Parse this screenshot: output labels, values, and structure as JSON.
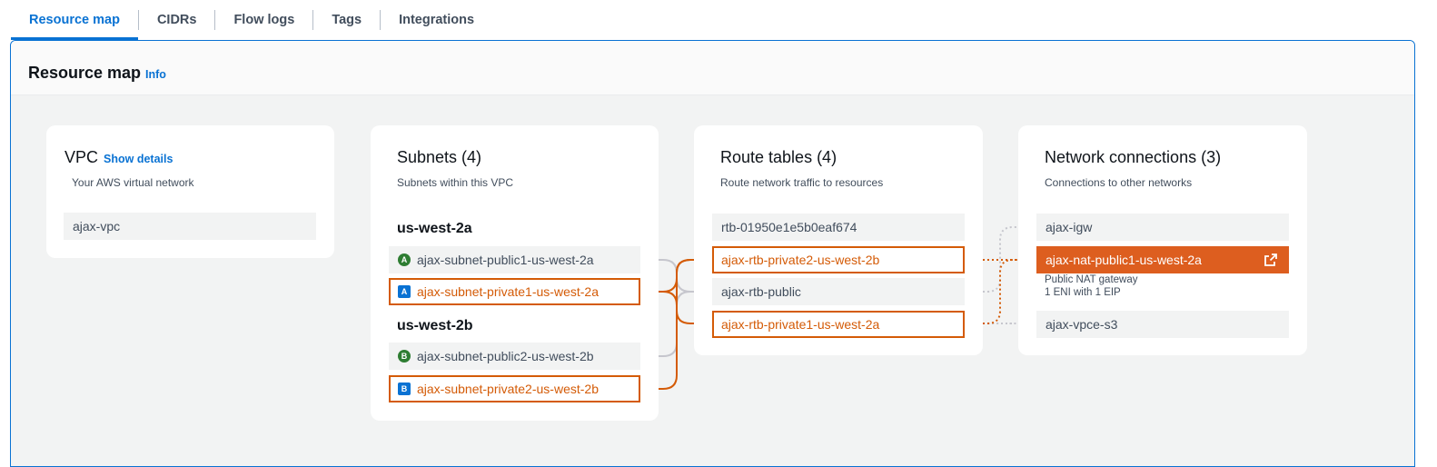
{
  "tabs": [
    {
      "label": "Resource map"
    },
    {
      "label": "CIDRs"
    },
    {
      "label": "Flow logs"
    },
    {
      "label": "Tags"
    },
    {
      "label": "Integrations"
    }
  ],
  "panel": {
    "title": "Resource map",
    "info": "Info"
  },
  "vpc": {
    "title": "VPC",
    "show_details": "Show details",
    "subtitle": "Your AWS virtual network",
    "name": "ajax-vpc"
  },
  "subnets": {
    "title": "Subnets (4)",
    "subtitle": "Subnets within this VPC",
    "zones": [
      {
        "name": "us-west-2a",
        "items": [
          {
            "badge": "A",
            "label": "ajax-subnet-public1-us-west-2a"
          },
          {
            "badge": "A",
            "label": "ajax-subnet-private1-us-west-2a"
          }
        ]
      },
      {
        "name": "us-west-2b",
        "items": [
          {
            "badge": "B",
            "label": "ajax-subnet-public2-us-west-2b"
          },
          {
            "badge": "B",
            "label": "ajax-subnet-private2-us-west-2b"
          }
        ]
      }
    ]
  },
  "route_tables": {
    "title": "Route tables (4)",
    "subtitle": "Route network traffic to resources",
    "items": [
      {
        "label": "rtb-01950e1e5b0eaf674"
      },
      {
        "label": "ajax-rtb-private2-us-west-2b"
      },
      {
        "label": "ajax-rtb-public"
      },
      {
        "label": "ajax-rtb-private1-us-west-2a"
      }
    ]
  },
  "network": {
    "title": "Network connections (3)",
    "subtitle": "Connections to other networks",
    "items": [
      {
        "label": "ajax-igw"
      },
      {
        "label": "ajax-nat-public1-us-west-2a",
        "type": "Public NAT gateway",
        "detail": "1 ENI with 1 EIP"
      },
      {
        "label": "ajax-vpce-s3"
      }
    ]
  },
  "icons": {
    "external_link": "external-link-icon",
    "public_subnet_badge": "public-subnet-badge",
    "private_subnet_badge": "private-subnet-badge"
  },
  "colors": {
    "accent": "#0972d3",
    "highlight": "#d45b07",
    "selected_fill": "#dd5e1f",
    "public_badge": "#2e7d32",
    "private_badge": "#0972d3",
    "connector": "#c6c6cd"
  }
}
